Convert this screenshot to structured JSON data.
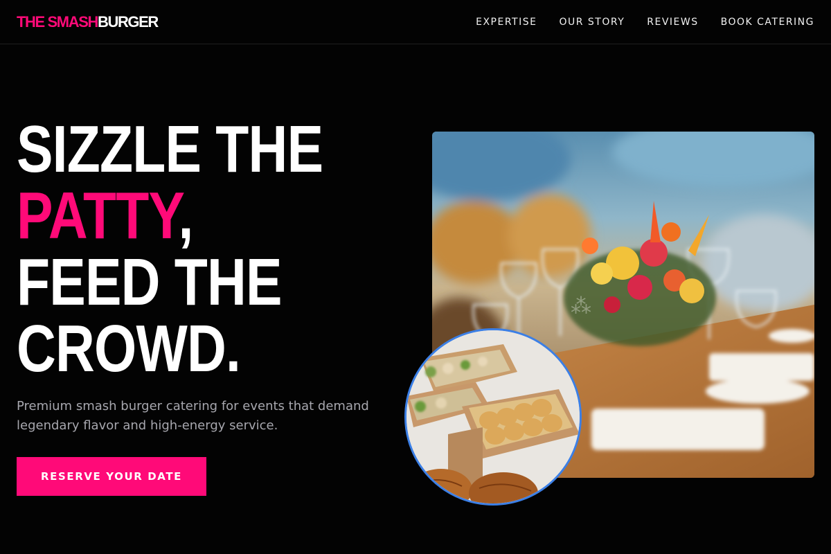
{
  "brand": {
    "accent_text": "THE SMASH",
    "rest_text": "BURGER",
    "accent_color": "#ff0a78"
  },
  "nav": {
    "links": [
      "EXPERTISE",
      "OUR STORY",
      "REVIEWS",
      "BOOK CATERING"
    ]
  },
  "hero": {
    "headline_line1": "SIZZLE THE",
    "headline_pink": "PATTY",
    "headline_comma": ",",
    "headline_line3": "FEED THE",
    "headline_line4": "CROWD.",
    "subtitle": "Premium smash burger catering for events that demand legendary flavor and high-energy service.",
    "cta_label": "RESERVE YOUR DATE"
  },
  "images": {
    "main": "banquet-table-flowers-photo",
    "inset": "boxed-sandwiches-catering-photo",
    "inset_border_color": "#3b7fe6"
  }
}
